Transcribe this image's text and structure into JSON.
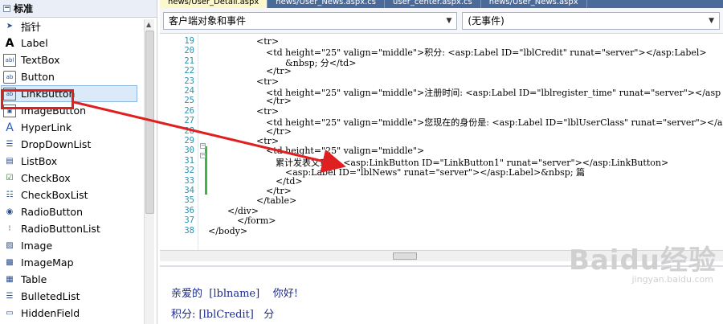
{
  "toolbox": {
    "header": "标准",
    "items": [
      {
        "label": "指针",
        "icon": "pointer-icon"
      },
      {
        "label": "Label",
        "icon": "label-icon"
      },
      {
        "label": "TextBox",
        "icon": "textbox-icon"
      },
      {
        "label": "Button",
        "icon": "button-icon"
      },
      {
        "label": "LinkButton",
        "icon": "linkbutton-icon",
        "selected": true
      },
      {
        "label": "ImageButton",
        "icon": "imagebutton-icon"
      },
      {
        "label": "HyperLink",
        "icon": "hyperlink-icon"
      },
      {
        "label": "DropDownList",
        "icon": "dropdownlist-icon"
      },
      {
        "label": "ListBox",
        "icon": "listbox-icon"
      },
      {
        "label": "CheckBox",
        "icon": "checkbox-icon"
      },
      {
        "label": "CheckBoxList",
        "icon": "checkboxlist-icon"
      },
      {
        "label": "RadioButton",
        "icon": "radiobutton-icon"
      },
      {
        "label": "RadioButtonList",
        "icon": "radiobuttonlist-icon"
      },
      {
        "label": "Image",
        "icon": "image-icon"
      },
      {
        "label": "ImageMap",
        "icon": "imagemap-icon"
      },
      {
        "label": "Table",
        "icon": "table-icon"
      },
      {
        "label": "BulletedList",
        "icon": "bulletedlist-icon"
      },
      {
        "label": "HiddenField",
        "icon": "hiddenfield-icon"
      }
    ]
  },
  "tabs": [
    {
      "label": "news/User_Detail.aspx",
      "active": true
    },
    {
      "label": "news/User_News.aspx.cs"
    },
    {
      "label": "user_center.aspx.cs"
    },
    {
      "label": "news/User_News.aspx"
    }
  ],
  "dropdowns": {
    "left": "客户端对象和事件",
    "right": "(无事件)"
  },
  "code_lines": [
    {
      "n": "19",
      "text": "<tr>"
    },
    {
      "n": "20",
      "text": "<td height=\"25\" valign=\"middle\">积分: <asp:Label ID=\"lblCredit\" runat=\"server\"></asp:Label>"
    },
    {
      "n": "21",
      "text": "&nbsp; 分</td>"
    },
    {
      "n": "22",
      "text": "</tr>"
    },
    {
      "n": "23",
      "text": "<tr>"
    },
    {
      "n": "24",
      "text": "<td height=\"25\" valign=\"middle\">注册时间: <asp:Label ID=\"lblregister_time\" runat=\"server\"></asp"
    },
    {
      "n": "25",
      "text": "</tr>"
    },
    {
      "n": "26",
      "text": "<tr>"
    },
    {
      "n": "27",
      "text": "<td height=\"25\" valign=\"middle\">您现在的身份是: <asp:Label ID=\"lblUserClass\" runat=\"server\"></a"
    },
    {
      "n": "28",
      "text": "</tr>"
    },
    {
      "n": "29",
      "text": "<tr>"
    },
    {
      "n": "30",
      "text": "<td height=\"25\" valign=\"middle\">"
    },
    {
      "n": "31",
      "text": "累计发表文章数: <asp:LinkButton ID=\"LinkButton1\" runat=\"server\"></asp:LinkButton>"
    },
    {
      "n": "32",
      "text": "<asp:Label ID=\"lblNews\" runat=\"server\"></asp:Label>&nbsp; 篇"
    },
    {
      "n": "33",
      "text": "</td>"
    },
    {
      "n": "34",
      "text": "</tr>"
    },
    {
      "n": "35",
      "text": "</table>"
    },
    {
      "n": "36",
      "text": "</div>"
    },
    {
      "n": "37",
      "text": "</form>"
    },
    {
      "n": "38",
      "text": "</body>"
    }
  ],
  "design_view": {
    "line1": "亲爱的  [lblname]    你好!",
    "line2": "积分: [lblCredit]   分"
  },
  "watermark": {
    "brand": "Baidu经验",
    "url": "jingyan.baidu.com"
  },
  "colors": {
    "annotation_red": "#e02020",
    "selection_blue": "#dbeaf8"
  }
}
